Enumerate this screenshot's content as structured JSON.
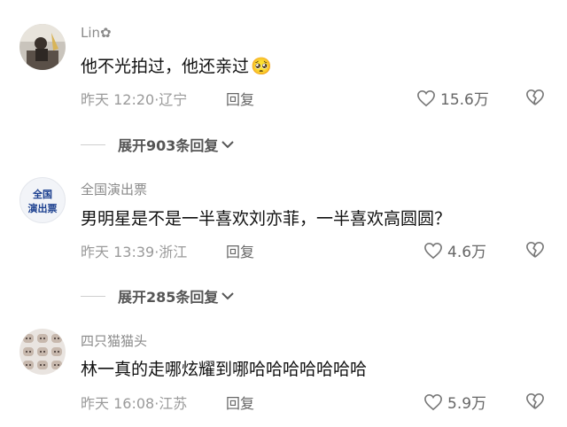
{
  "comments": [
    {
      "username": "Lin✿",
      "text": "他不光拍过，他还亲过",
      "emoji": "🥺",
      "time_location": "昨天 12:20·辽宁",
      "reply_label": "回复",
      "likes": "15.6万",
      "expand_label": "展开903条回复"
    },
    {
      "username": "全国演出票",
      "avatar_text_top": "全国",
      "avatar_text_bottom": "演出票",
      "text": "男明星是不是一半喜欢刘亦菲，一半喜欢高圆圆？",
      "time_location": "昨天 13:39·浙江",
      "reply_label": "回复",
      "likes": "4.6万",
      "expand_label": "展开285条回复"
    },
    {
      "username": "四只猫猫头",
      "text": "林一真的走哪炫耀到哪哈哈哈哈哈哈哈",
      "time_location": "昨天 16:08·江苏",
      "reply_label": "回复",
      "likes": "5.9万"
    }
  ],
  "icons": {
    "like": "heart-outline-icon",
    "dislike": "broken-heart-icon",
    "expand": "chevron-down-icon"
  }
}
